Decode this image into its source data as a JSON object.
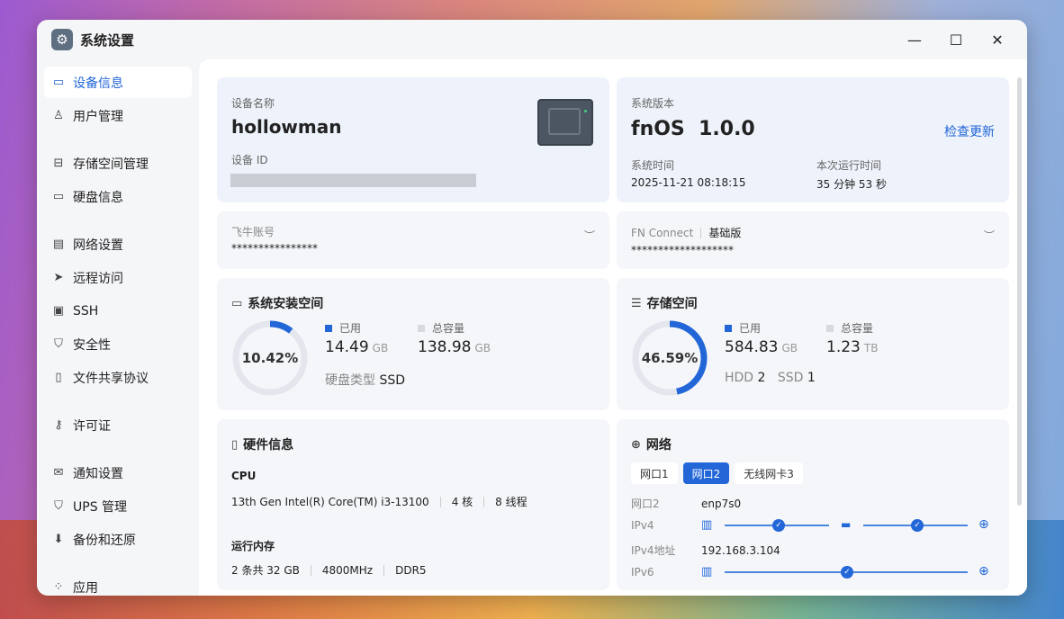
{
  "window": {
    "title": "系统设置",
    "minimize": "—",
    "maximize": "☐",
    "close": "✕"
  },
  "sidebar": {
    "items": [
      {
        "label": "设备信息",
        "icon": "drive-icon",
        "glyph": "▭"
      },
      {
        "label": "用户管理",
        "icon": "users-icon",
        "glyph": "♙"
      },
      {
        "label": "存储空间管理",
        "icon": "storage-icon",
        "glyph": "⊟"
      },
      {
        "label": "硬盘信息",
        "icon": "disk-icon",
        "glyph": "▭"
      },
      {
        "label": "网络设置",
        "icon": "network-icon",
        "glyph": "▤"
      },
      {
        "label": "远程访问",
        "icon": "send-icon",
        "glyph": "➤"
      },
      {
        "label": "SSH",
        "icon": "ssh-icon",
        "glyph": "▣"
      },
      {
        "label": "安全性",
        "icon": "shield-icon",
        "glyph": "⛉"
      },
      {
        "label": "文件共享协议",
        "icon": "file-icon",
        "glyph": "▯"
      },
      {
        "label": "许可证",
        "icon": "key-icon",
        "glyph": "⚷"
      },
      {
        "label": "通知设置",
        "icon": "mail-icon",
        "glyph": "✉"
      },
      {
        "label": "UPS 管理",
        "icon": "ups-icon",
        "glyph": "⛉"
      },
      {
        "label": "备份和还原",
        "icon": "backup-icon",
        "glyph": "⬇"
      },
      {
        "label": "应用",
        "icon": "apps-icon",
        "glyph": "⁘"
      }
    ]
  },
  "device": {
    "name_label": "设备名称",
    "name": "hollowman",
    "id_label": "设备 ID"
  },
  "system": {
    "version_label": "系统版本",
    "version": "fnOS  1.0.0",
    "check_update": "检查更新",
    "time_label": "系统时间",
    "time": "2025-11-21 08:18:15",
    "uptime_label": "本次运行时间",
    "uptime": "35 分钟 53 秒"
  },
  "account": {
    "label": "飞牛账号",
    "value": "****************"
  },
  "fnconnect": {
    "label": "FN Connect",
    "tier": "基础版",
    "value": "*******************"
  },
  "install_space": {
    "title": "系统安装空间",
    "percent_text": "10.42%",
    "percent": 10.42,
    "used_label": "已用",
    "used": "14.49",
    "used_unit": "GB",
    "total_label": "总容量",
    "total": "138.98",
    "total_unit": "GB",
    "disk_type_label": "硬盘类型",
    "disk_type": "SSD"
  },
  "storage": {
    "title": "存储空间",
    "percent_text": "46.59%",
    "percent": 46.59,
    "used_label": "已用",
    "used": "584.83",
    "used_unit": "GB",
    "total_label": "总容量",
    "total": "1.23",
    "total_unit": "TB",
    "hdd_label": "HDD",
    "hdd": "2",
    "ssd_label": "SSD",
    "ssd": "1"
  },
  "hardware": {
    "title": "硬件信息",
    "cpu_label": "CPU",
    "cpu": "13th Gen Intel(R) Core(TM) i3-13100",
    "cores": "4 核",
    "threads": "8 线程",
    "mem_label": "运行内存",
    "mem": "2 条共 32 GB",
    "mem_speed": "4800MHz",
    "mem_type": "DDR5"
  },
  "network": {
    "title": "网络",
    "tabs": [
      "网口1",
      "网口2",
      "无线网卡3"
    ],
    "port_label": "网口2",
    "port": "enp7s0",
    "ipv4_label": "IPv4",
    "ipv4_addr_label": "IPv4地址",
    "ipv4_addr": "192.168.3.104",
    "ipv6_label": "IPv6"
  },
  "colors": {
    "accent": "#2266d8",
    "ring_bg": "#e3e6ec"
  }
}
